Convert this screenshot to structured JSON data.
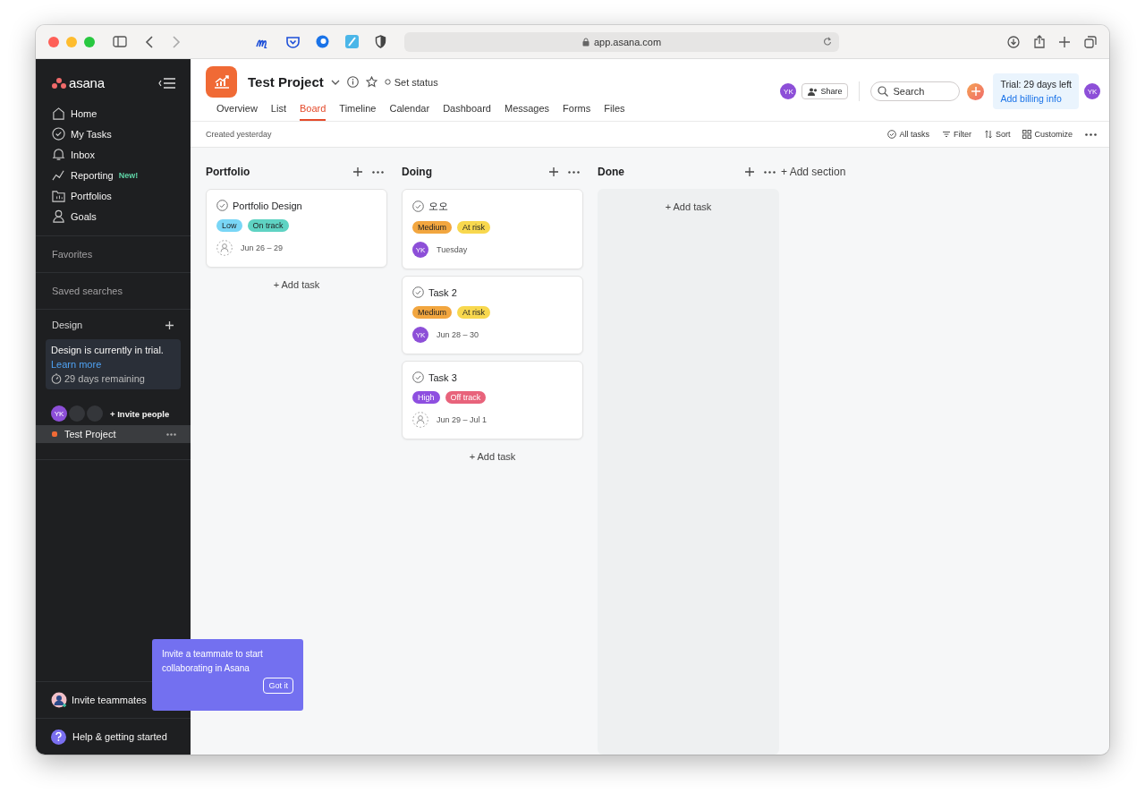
{
  "browser": {
    "url": "app.asana.com"
  },
  "sidebar": {
    "logo": "asana",
    "nav": [
      {
        "label": "Home"
      },
      {
        "label": "My Tasks"
      },
      {
        "label": "Inbox"
      },
      {
        "label": "Reporting",
        "badge": "New!"
      },
      {
        "label": "Portfolios"
      },
      {
        "label": "Goals"
      }
    ],
    "sections": [
      "Favorites",
      "Saved searches"
    ],
    "team": {
      "name": "Design",
      "trial_text": "Design is currently in trial.",
      "trial_link": "Learn more",
      "remaining": "29 days remaining",
      "member": "YK",
      "invite": "+ Invite people"
    },
    "projects": [
      {
        "name": "Test Project",
        "color": "#f06a35",
        "selected": true
      }
    ],
    "invite_teammates": "Invite teammates",
    "help": "Help & getting started"
  },
  "project": {
    "title": "Test Project",
    "set_status": "Set status",
    "share": "Share",
    "search_placeholder": "Search",
    "member": "YK",
    "user": "YK",
    "trial_title": "Trial: 29 days left",
    "trial_link": "Add billing info",
    "tabs": [
      {
        "label": "Overview",
        "selected": false
      },
      {
        "label": "List",
        "selected": false
      },
      {
        "label": "Board",
        "selected": true
      },
      {
        "label": "Timeline",
        "selected": false
      },
      {
        "label": "Calendar",
        "selected": false
      },
      {
        "label": "Dashboard",
        "selected": false
      },
      {
        "label": "Messages",
        "selected": false
      },
      {
        "label": "Forms",
        "selected": false
      },
      {
        "label": "Files",
        "selected": false
      }
    ],
    "created": "Created yesterday",
    "tools": [
      "All tasks",
      "Filter",
      "Sort",
      "Customize"
    ]
  },
  "columns": [
    {
      "name": "Portfolio",
      "add_task": "+ Add task",
      "tasks": [
        {
          "title": "Portfolio Design",
          "tags": [
            {
              "label": "Low",
              "color": "#79d6f6"
            },
            {
              "label": "On track",
              "color": "#5fd3c3"
            }
          ],
          "date": "Jun 26 – 29"
        }
      ]
    },
    {
      "name": "Doing",
      "add_task": "+ Add task",
      "tasks": [
        {
          "title": "오오",
          "tags": [
            {
              "label": "Medium",
              "color": "#f2a63f"
            },
            {
              "label": "At risk",
              "color": "#f8d84e"
            }
          ],
          "assignee": "YK",
          "date": "Tuesday"
        },
        {
          "title": "Task 2",
          "tags": [
            {
              "label": "Medium",
              "color": "#f2a63f"
            },
            {
              "label": "At risk",
              "color": "#f8d84e"
            }
          ],
          "assignee": "YK",
          "date": "Jun 28 – 30"
        },
        {
          "title": "Task 3",
          "tags": [
            {
              "label": "High",
              "color": "#8e4fe0"
            },
            {
              "label": "Off track",
              "color": "#e8637b"
            }
          ],
          "date": "Jun 29 – Jul 1"
        }
      ]
    },
    {
      "name": "Done",
      "add_task": "+ Add task"
    }
  ],
  "add_section": "+ Add section",
  "tooltip": {
    "text": "Invite a teammate to start collaborating in Asana",
    "button": "Got it"
  }
}
